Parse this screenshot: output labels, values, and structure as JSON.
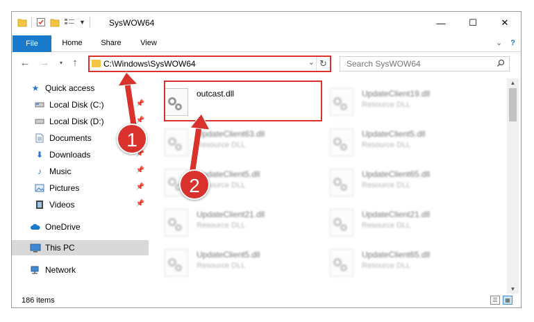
{
  "window": {
    "title": "SysWOW64",
    "minimize": "—",
    "maximize": "☐",
    "close": "✕"
  },
  "ribbon": {
    "file": "File",
    "home": "Home",
    "share": "Share",
    "view": "View",
    "collapse": "⌄",
    "help": "?"
  },
  "address": {
    "path": "C:\\Windows\\SysWOW64",
    "search_placeholder": "Search SysWOW64"
  },
  "sidebar": {
    "items": [
      {
        "label": "Quick access",
        "icon": "star-icon"
      },
      {
        "label": "Local Disk (C:)",
        "icon": "drive-icon"
      },
      {
        "label": "Local Disk (D:)",
        "icon": "drive-icon"
      },
      {
        "label": "Documents",
        "icon": "documents-icon"
      },
      {
        "label": "Downloads",
        "icon": "download-icon"
      },
      {
        "label": "Music",
        "icon": "music-icon"
      },
      {
        "label": "Pictures",
        "icon": "pictures-icon"
      },
      {
        "label": "Videos",
        "icon": "videos-icon"
      },
      {
        "label": "OneDrive",
        "icon": "cloud-icon"
      },
      {
        "label": "This PC",
        "icon": "computer-icon"
      },
      {
        "label": "Network",
        "icon": "network-icon"
      }
    ]
  },
  "files": [
    {
      "name": "outcast.dll",
      "type": ""
    },
    {
      "name": "UpdateClient19.dll",
      "type": "Resource DLL"
    },
    {
      "name": "UpdateClient63.dll",
      "type": "Resource DLL"
    },
    {
      "name": "UpdateClient5.dll",
      "type": "Resource DLL"
    },
    {
      "name": "UpdateClient5.dll",
      "type": "Resource DLL"
    },
    {
      "name": "UpdateClient65.dll",
      "type": "Resource DLL"
    },
    {
      "name": "UpdateClient21.dll",
      "type": "Resource DLL"
    },
    {
      "name": "UpdateClient21.dll",
      "type": "Resource DLL"
    },
    {
      "name": "UpdateClient5.dll",
      "type": "Resource DLL"
    },
    {
      "name": "UpdateClient65.dll",
      "type": "Resource DLL"
    }
  ],
  "status": {
    "count": "186 items"
  },
  "callouts": {
    "one": "1",
    "two": "2"
  },
  "colors": {
    "accent": "#1979ca",
    "callout": "#d9312b",
    "selected": "#d9d9d9"
  }
}
